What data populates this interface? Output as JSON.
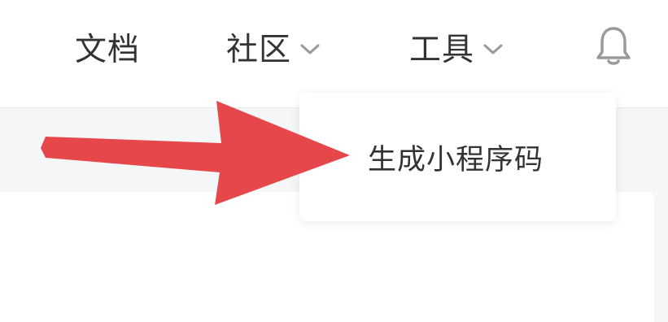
{
  "nav": {
    "docs": "文档",
    "community": "社区",
    "tools": "工具"
  },
  "dropdown": {
    "items": [
      "生成小程序码"
    ]
  },
  "icons": {
    "bell": "bell-icon",
    "chevron": "chevron-down-icon",
    "arrow": "red-arrow-annotation"
  },
  "colors": {
    "arrow": "#e5474b",
    "text": "#333333",
    "muted": "#9a9a9a",
    "background": "#f5f6f7"
  }
}
